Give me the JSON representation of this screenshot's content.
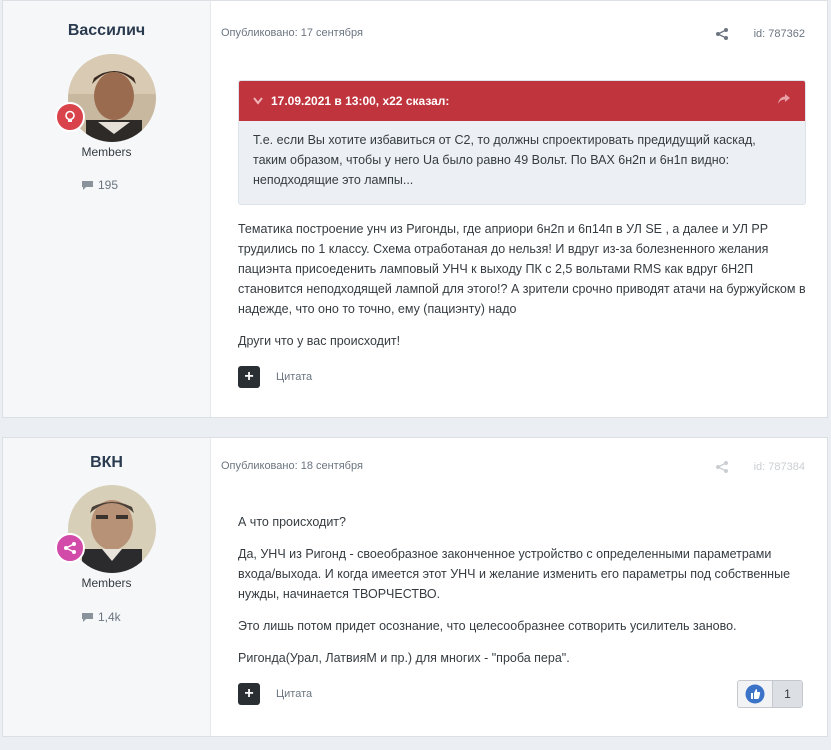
{
  "posts": [
    {
      "author": "Вассилич",
      "group": "Members",
      "post_count": "195",
      "published": "Опубликовано: 17 сентября",
      "id_label": "id: 787362",
      "quote": {
        "header": "17.09.2021 в 13:00, x22 сказал:",
        "text": "Т.е. если Вы хотите избавиться от С2, то должны спроектировать предидущий каскад, таким образом, чтобы у него Ua было равно 49 Вольт. По ВАХ 6н2п и 6н1п видно: неподходящие это лампы..."
      },
      "paragraphs": [
        "Тематика построение унч из Ригонды, где априори 6н2п и 6п14п в УЛ SE , а далее и УЛ РР трудились по 1 классу. Схема отработаная до нельзя! И вдруг из-за болезненного желания пациэнта присоеденить ламповый УНЧ к выходу ПК с 2,5 вольтами RMS как вдруг 6Н2П становится неподходящей лампой для этого!? А зрители срочно приводят атачи на буржуйском в надежде, что оно то точно, ему (пациэнту) надо",
        "Други что у вас происходит!"
      ],
      "quote_button": "Цитата",
      "badge_color": "#d9434b"
    },
    {
      "author": "ВКН",
      "group": "Members",
      "post_count": "1,4k",
      "published": "Опубликовано: 18 сентября",
      "id_label": "id: 787384",
      "paragraphs": [
        "А что происходит?",
        "Да, УНЧ из Ригонд - своеобразное законченное устройство с определенными параметрами входа/выхода. И когда имеется этот УНЧ и желание изменить его параметры под собственные нужды, начинается ТВОРЧЕСТВО.",
        "Это лишь потом придет осознание, что целесообразнее сотворить усилитель заново.",
        "Ригонда(Урал, ЛатвияМ и пр.) для многих - \"проба пера\"."
      ],
      "quote_button": "Цитата",
      "reaction_count": "1",
      "badge_color": "#d24ba8"
    }
  ],
  "icons": {
    "share": "share-icon",
    "comment": "comment-icon",
    "lightbulb": "lightbulb-icon",
    "network": "share-network-icon",
    "like": "like-icon",
    "plus": "plus-icon"
  }
}
